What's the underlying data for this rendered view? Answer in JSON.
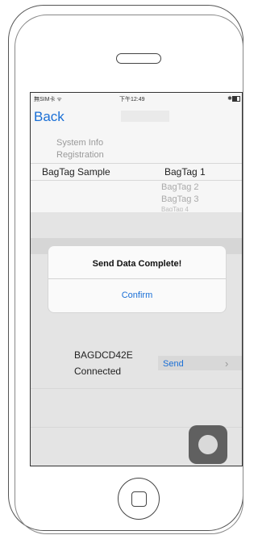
{
  "status": {
    "left": "無SIM卡 ᯤ",
    "time": "下午12:49",
    "right": "✱"
  },
  "nav": {
    "back_label": "Back"
  },
  "menu": {
    "item_1": "System Info",
    "item_2": "Registration"
  },
  "form": {
    "label": "BagTag Sample",
    "selected_value": "BagTag 1"
  },
  "picker": {
    "options": [
      "BagTag 2",
      "BagTag 3",
      "BagTag 4"
    ]
  },
  "alert": {
    "title": "Send Data Complete!",
    "confirm_label": "Confirm"
  },
  "device": {
    "name": "BAGDCD42E",
    "state": "Connected",
    "send_label": "Send",
    "chevron": "›"
  },
  "colors": {
    "accent": "#1a6fd6"
  }
}
